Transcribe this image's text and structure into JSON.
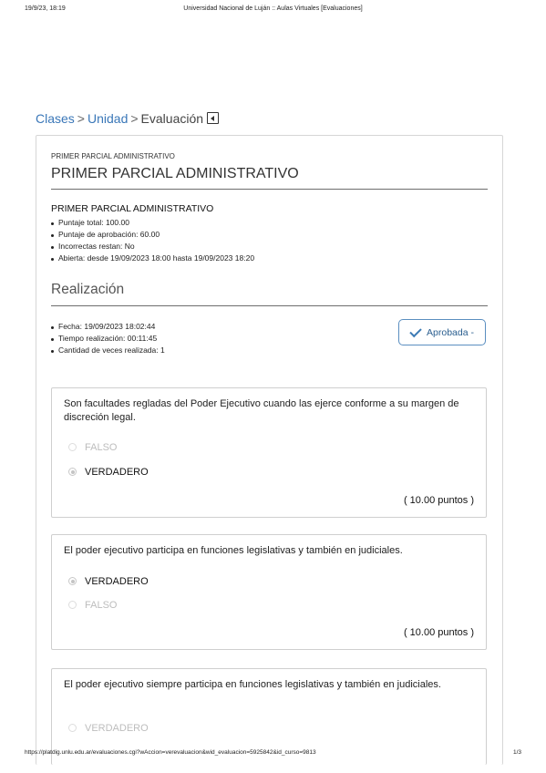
{
  "print_header": {
    "datetime": "19/9/23, 18:19",
    "title": "Universidad Nacional de Luján :: Aulas Virtuales [Evaluaciones]"
  },
  "breadcrumb": {
    "items": [
      "Clases",
      "Unidad"
    ],
    "current": "Evaluación",
    "separator": ">"
  },
  "evaluation": {
    "sup_title": "PRIMER PARCIAL ADMINISTRATIVO",
    "title": "PRIMER PARCIAL ADMINISTRATIVO",
    "info_title": "PRIMER PARCIAL ADMINISTRATIVO",
    "details": [
      "Puntaje total: 100.00",
      "Puntaje de aprobación: 60.00",
      "Incorrectas restan: No",
      "Abierta: desde 19/09/2023 18:00 hasta 19/09/2023 18:20"
    ]
  },
  "realizacion": {
    "title": "Realización",
    "details": [
      "Fecha: 19/09/2023 18:02:44",
      "Tiempo realización: 00:11:45",
      "Cantidad de veces realizada: 1"
    ],
    "status_label": "Aprobada -",
    "status_icon": "check-icon",
    "accent_color": "#3d7bb5"
  },
  "questions": [
    {
      "text": "Son facultades regladas del Poder Ejecutivo  cuando las ejerce conforme a su margen de discreción legal.",
      "options": [
        {
          "label": "FALSO",
          "selected": false
        },
        {
          "label": "VERDADERO",
          "selected": true
        }
      ],
      "score": "( 10.00 puntos )"
    },
    {
      "text": "El poder ejecutivo participa en funciones legislativas y también en judiciales.",
      "options": [
        {
          "label": "VERDADERO",
          "selected": true
        },
        {
          "label": "FALSO",
          "selected": false
        }
      ],
      "score": "( 10.00 puntos )"
    },
    {
      "text": "El poder ejecutivo siempre participa en funciones legislativas y también en judiciales.",
      "options": [
        {
          "label": "VERDADERO",
          "selected": false
        }
      ]
    }
  ],
  "print_footer": {
    "url": "https://platdig.unlu.edu.ar/evaluaciones.cgi?wAccion=verevaluacion&wid_evaluacion=5925842&id_curso=9813",
    "page": "1/3"
  }
}
